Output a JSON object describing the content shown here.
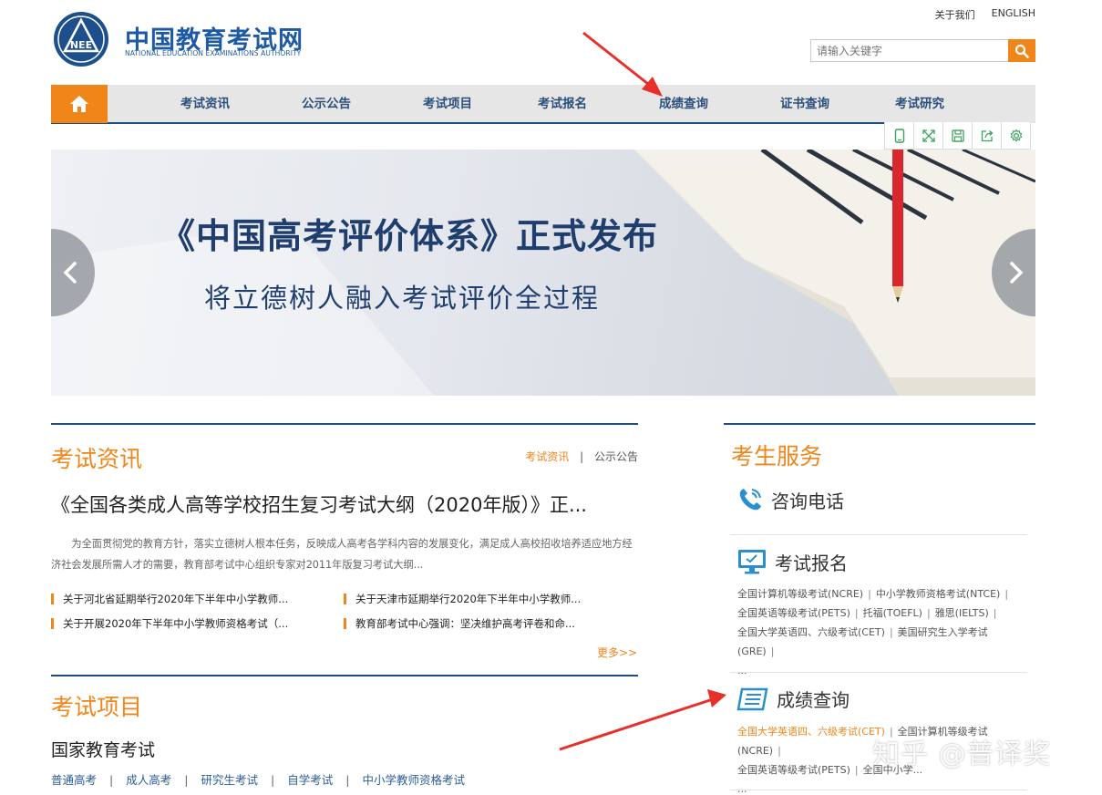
{
  "header": {
    "site_name": "中国教育考试网",
    "site_name_en": "NATIONAL EDUCATION EXAMINATIONS AUTHORITY",
    "logo_text": "NEEA",
    "about_label": "关于我们",
    "english_label": "ENGLISH",
    "search_placeholder": "请输入关键字"
  },
  "colors": {
    "brand_blue": "#1f4d7d",
    "accent_orange": "#f08519",
    "annotation_red": "#e8302a"
  },
  "nav": {
    "home_icon": "home-icon",
    "items": [
      "考试资讯",
      "公示公告",
      "考试项目",
      "考试报名",
      "成绩查询",
      "证书查询",
      "考试研究"
    ]
  },
  "toolbar": {
    "icons": [
      "mobile-icon",
      "fullscreen-icon",
      "save-icon",
      "share-icon",
      "settings-icon"
    ]
  },
  "banner": {
    "title": "《中国高考评价体系》正式发布",
    "subtitle": "将立德树人融入考试评价全过程"
  },
  "news": {
    "title": "考试资讯",
    "tab_active": "考试资讯",
    "tab_sep": "|",
    "tab_other": "公示公告",
    "headline": "《全国各类成人高等学校招生复习考试大纲（2020年版）》正...",
    "summary": "为全面贯彻党的教育方针，落实立德树人根本任务，反映成人高考各学科内容的发展变化，满足成人高校招收培养适应地方经济社会发展所需人才的需要，教育部考试中心组织专家对2011年版复习考试大纲...",
    "items": [
      "关于河北省延期举行2020年下半年中小学教师...",
      "关于天津市延期举行2020年下半年中小学教师...",
      "关于开展2020年下半年中小学教师资格考试（...",
      "教育部考试中心强调：坚决维护高考评卷和命..."
    ],
    "more": "更多>>"
  },
  "exams": {
    "title": "考试项目",
    "subtitle": "国家教育考试",
    "links": [
      "普通高考",
      "成人高考",
      "研究生考试",
      "自学考试",
      "中小学教师资格考试"
    ],
    "sep": "|"
  },
  "service": {
    "title": "考生服务",
    "phone_label": "咨询电话",
    "register_label": "考试报名",
    "register_links": [
      "全国计算机等级考试(NCRE)",
      "中小学教师资格考试(NTCE)",
      "全国英语等级考试(PETS)",
      "托福(TOEFL)",
      "雅思(IELTS)",
      "全国大学英语四、六级考试(CET)",
      "美国研究生入学考试(GRE)"
    ],
    "score_label": "成绩查询",
    "score_links": [
      "全国大学英语四、六级考试(CET)",
      "全国计算机等级考试(NCRE)",
      "全国英语等级考试(PETS)",
      "全国中小学..."
    ],
    "sep": "|",
    "ellipsis": "..."
  },
  "watermark": "知乎 @普译奖"
}
